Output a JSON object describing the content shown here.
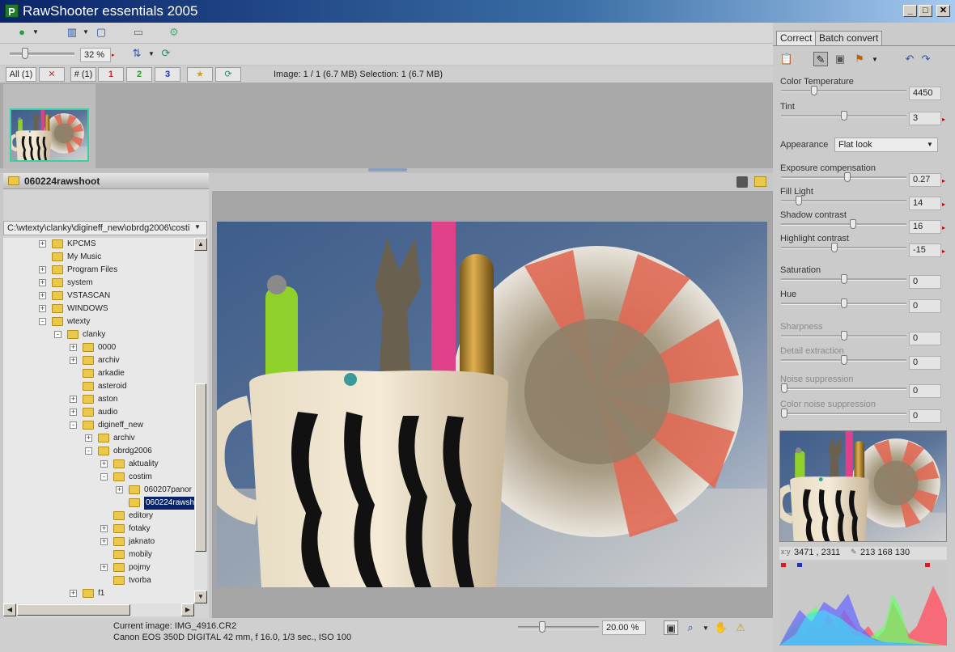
{
  "window": {
    "title": "RawShooter essentials 2005",
    "minimize": "_",
    "maximize": "□",
    "close": "✕"
  },
  "toolbar": {
    "zoom_value": "32 %"
  },
  "filter_tabs": {
    "all": "All (1)",
    "hash": "# (1)",
    "p1": "1",
    "p2": "2",
    "p3": "3",
    "info": "Image: 1 / 1 (6.7 MB) Selection: 1 (6.7 MB)"
  },
  "folder_panel": {
    "title": "060224rawshoot",
    "path": "C:\\wtexty\\clanky\\digineff_new\\obrdg2006\\costi",
    "tree": [
      {
        "label": "KPCMS",
        "depth": 0,
        "exp": "+"
      },
      {
        "label": "My Music",
        "depth": 0,
        "exp": ""
      },
      {
        "label": "Program Files",
        "depth": 0,
        "exp": "+"
      },
      {
        "label": "system",
        "depth": 0,
        "exp": "+"
      },
      {
        "label": "VSTASCAN",
        "depth": 0,
        "exp": "+"
      },
      {
        "label": "WINDOWS",
        "depth": 0,
        "exp": "+"
      },
      {
        "label": "wtexty",
        "depth": 0,
        "exp": "-"
      },
      {
        "label": "clanky",
        "depth": 1,
        "exp": "-"
      },
      {
        "label": "0000",
        "depth": 2,
        "exp": "+"
      },
      {
        "label": "archiv",
        "depth": 2,
        "exp": "+"
      },
      {
        "label": "arkadie",
        "depth": 2,
        "exp": ""
      },
      {
        "label": "asteroid",
        "depth": 2,
        "exp": ""
      },
      {
        "label": "aston",
        "depth": 2,
        "exp": "+"
      },
      {
        "label": "audio",
        "depth": 2,
        "exp": "+"
      },
      {
        "label": "digineff_new",
        "depth": 2,
        "exp": "-"
      },
      {
        "label": "archiv",
        "depth": 3,
        "exp": "+"
      },
      {
        "label": "obrdg2006",
        "depth": 3,
        "exp": "-"
      },
      {
        "label": "aktuality",
        "depth": 4,
        "exp": "+"
      },
      {
        "label": "costim",
        "depth": 4,
        "exp": "-"
      },
      {
        "label": "060207panor",
        "depth": 5,
        "exp": "+"
      },
      {
        "label": "060224rawsh",
        "depth": 5,
        "exp": "",
        "selected": true
      },
      {
        "label": "editory",
        "depth": 4,
        "exp": ""
      },
      {
        "label": "fotaky",
        "depth": 4,
        "exp": "+"
      },
      {
        "label": "jaknato",
        "depth": 4,
        "exp": "+"
      },
      {
        "label": "mobily",
        "depth": 4,
        "exp": ""
      },
      {
        "label": "pojmy",
        "depth": 4,
        "exp": "+"
      },
      {
        "label": "tvorba",
        "depth": 4,
        "exp": ""
      },
      {
        "label": "f1",
        "depth": 2,
        "exp": "+"
      }
    ]
  },
  "status": {
    "current_image": "Current image: IMG_4916.CR2",
    "camera_info": "Canon EOS 350D DIGITAL   42 mm, f 16.0, 1/3 sec., ISO 100",
    "zoom": "20.00 %"
  },
  "right_panel": {
    "tab_correct": "Correct",
    "tab_batch": "Batch convert",
    "appearance_label": "Appearance",
    "appearance_value": "Flat look",
    "controls": [
      {
        "id": "color-temperature",
        "label": "Color Temperature",
        "value": "4450",
        "level": 0.25,
        "arrow": false,
        "dim": false
      },
      {
        "id": "tint",
        "label": "Tint",
        "value": "3",
        "level": 0.5,
        "arrow": true,
        "dim": false
      },
      {
        "id": "exposure-compensation",
        "label": "Exposure compensation",
        "value": "0.27",
        "level": 0.53,
        "arrow": true,
        "dim": false
      },
      {
        "id": "fill-light",
        "label": "Fill Light",
        "value": "14",
        "level": 0.12,
        "arrow": true,
        "dim": false
      },
      {
        "id": "shadow-contrast",
        "label": "Shadow contrast",
        "value": "16",
        "level": 0.58,
        "arrow": true,
        "dim": false
      },
      {
        "id": "highlight-contrast",
        "label": "Highlight contrast",
        "value": "-15",
        "level": 0.42,
        "arrow": true,
        "dim": false
      },
      {
        "id": "saturation",
        "label": "Saturation",
        "value": "0",
        "level": 0.5,
        "arrow": false,
        "dim": false
      },
      {
        "id": "hue",
        "label": "Hue",
        "value": "0",
        "level": 0.5,
        "arrow": false,
        "dim": false
      },
      {
        "id": "sharpness",
        "label": "Sharpness",
        "value": "0",
        "level": 0.5,
        "arrow": false,
        "dim": true
      },
      {
        "id": "detail-extraction",
        "label": "Detail extraction",
        "value": "0",
        "level": 0.5,
        "arrow": false,
        "dim": true
      },
      {
        "id": "noise-suppression",
        "label": "Noise suppression",
        "value": "0",
        "level": 0.0,
        "arrow": false,
        "dim": true
      },
      {
        "id": "color-noise-suppression",
        "label": "Color noise suppression",
        "value": "0",
        "level": 0.0,
        "arrow": false,
        "dim": true
      }
    ],
    "coord_xy_label": "x:y",
    "coord_xy": "3471 , 2311",
    "coord_rgb": "213    168    130"
  }
}
